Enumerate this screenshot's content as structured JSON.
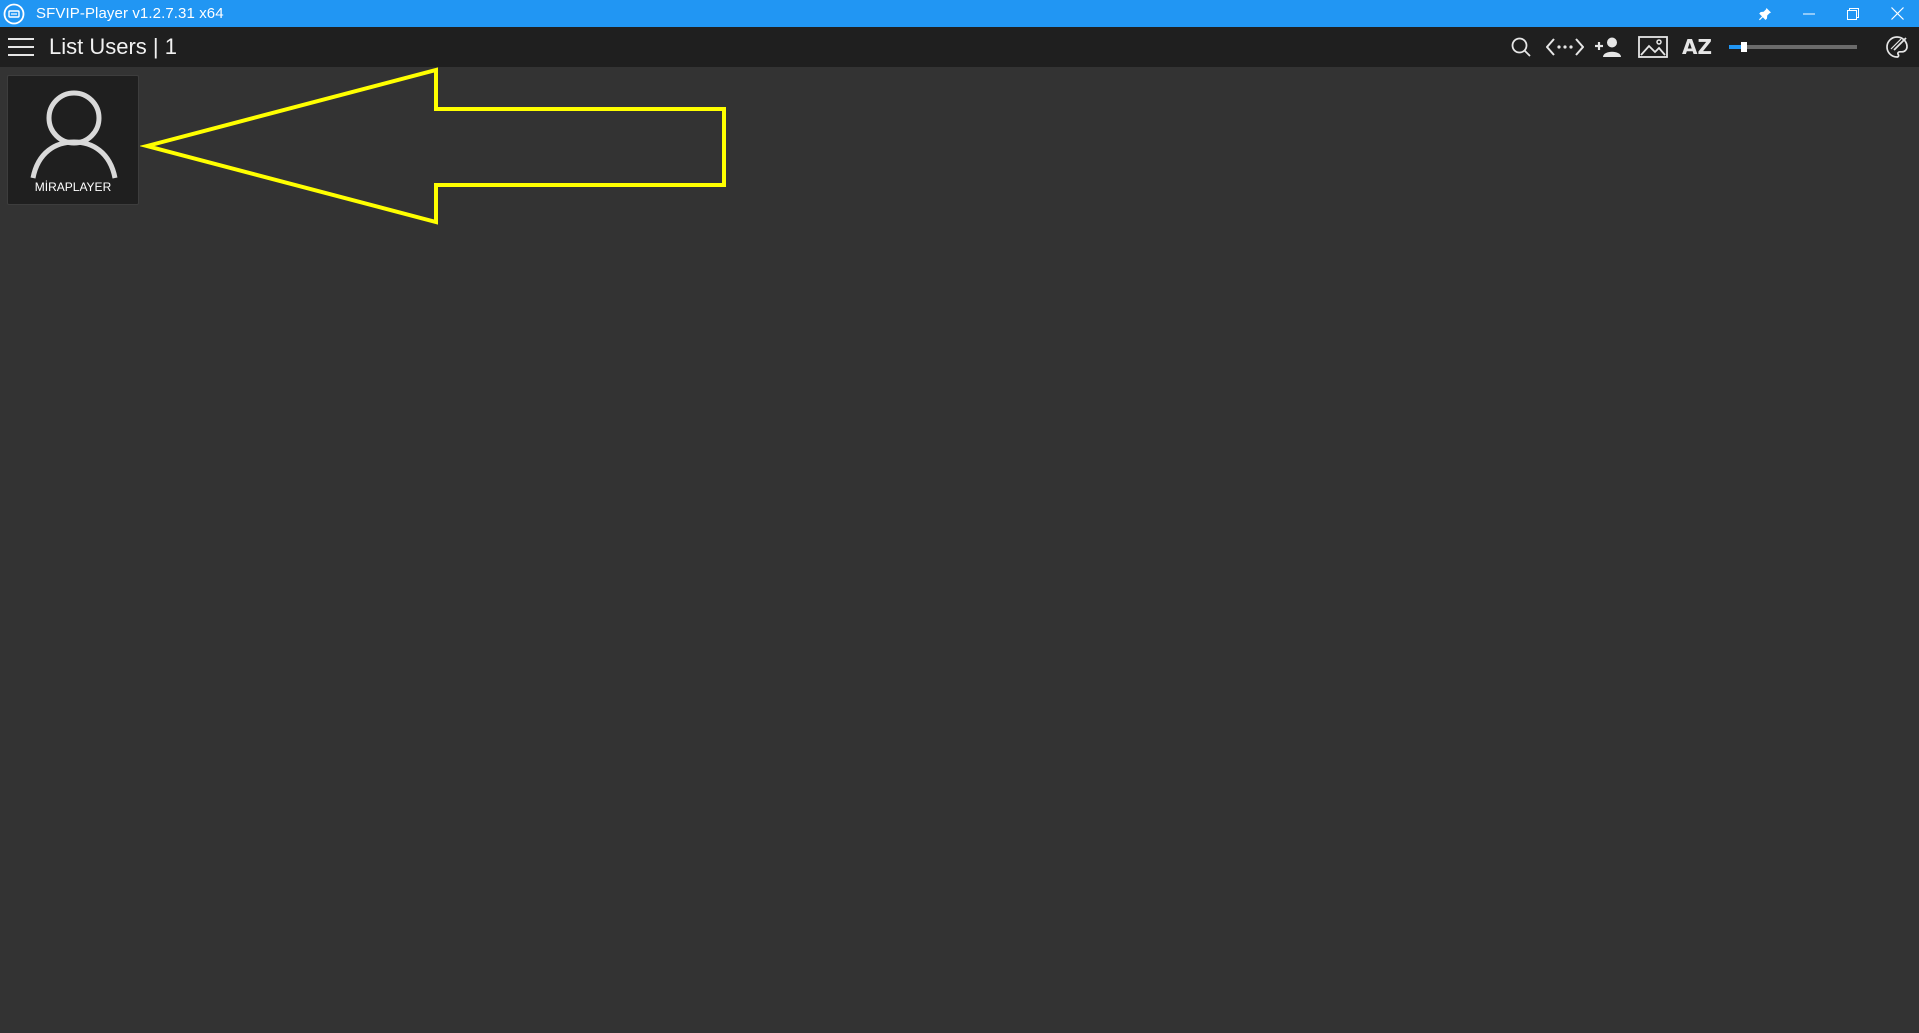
{
  "window": {
    "title": "SFVIP-Player v1.2.7.31 x64",
    "logo_icon": "sfvip-logo-icon",
    "titlebar_color": "#2196f3",
    "controls": [
      "pin-icon",
      "minimize-icon",
      "restore-icon",
      "close-icon"
    ]
  },
  "toolbar": {
    "menu_icon": "hamburger-menu-icon",
    "title": "List Users | 1",
    "icons": [
      "search-icon",
      "code-brackets-icon",
      "add-user-icon",
      "image-icon",
      "sort-az-icon",
      "theme-palette-icon"
    ],
    "sort_label": "AZ",
    "zoom_level": 0.05
  },
  "users": [
    {
      "name": "MİRAPLAYER",
      "icon": "user-avatar-icon"
    }
  ],
  "annotation": {
    "type": "arrow",
    "direction": "left",
    "color": "#ffff00",
    "points_to": "user-card"
  }
}
